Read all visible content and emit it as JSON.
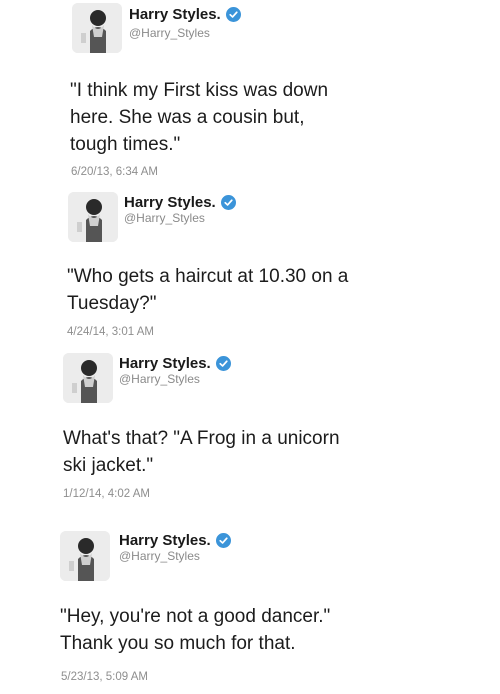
{
  "tweets": [
    {
      "name": "Harry Styles.",
      "handle": "@Harry_Styles",
      "text": "\"I think my First kiss was down\nhere. She was a cousin but,\ntough times.\"",
      "timestamp": "6/20/13, 6:34 AM",
      "verified": true
    },
    {
      "name": "Harry Styles.",
      "handle": "@Harry_Styles",
      "text": "\"Who gets a haircut at 10.30 on a\nTuesday?\"",
      "timestamp": "4/24/14, 3:01 AM",
      "verified": true
    },
    {
      "name": "Harry Styles.",
      "handle": "@Harry_Styles",
      "text": "What's that? \"A Frog in a unicorn\nski jacket.\"",
      "timestamp": "1/12/14, 4:02 AM",
      "verified": true
    },
    {
      "name": "Harry Styles.",
      "handle": "@Harry_Styles",
      "text": "\"Hey, you're not a good dancer.\"\nThank you so much for that.",
      "timestamp": "5/23/13, 5:09 AM",
      "verified": true
    }
  ],
  "colors": {
    "verified_badge": "#3b94d9",
    "timestamp": "#8e8e8e",
    "handle": "#8a8a8a"
  },
  "icons": {
    "verified": "verified-badge-icon",
    "avatar": "profile-photo"
  }
}
